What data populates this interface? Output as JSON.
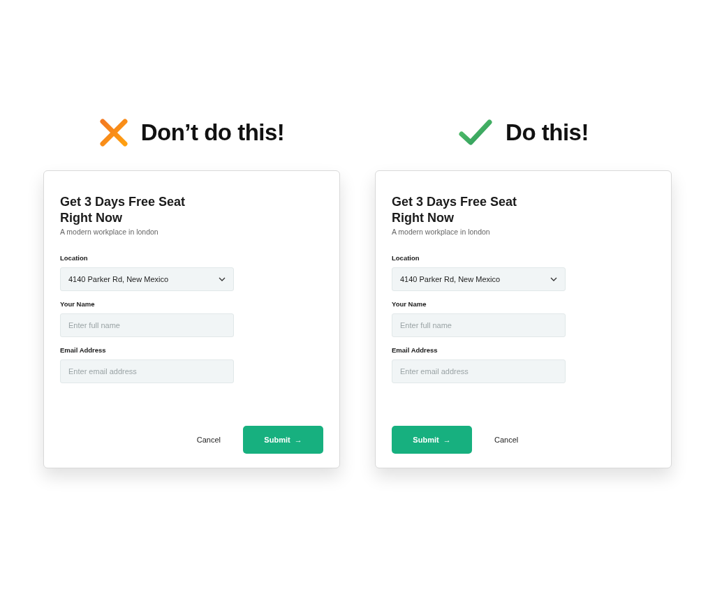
{
  "examples": [
    {
      "kind": "dont",
      "heading": "Don’t do this!",
      "form": {
        "title": "Get 3 Days Free Seat Right Now",
        "subtitle": "A modern workplace in london",
        "fields": [
          {
            "kind": "select",
            "label": "Location",
            "value": "4140 Parker Rd, New Mexico"
          },
          {
            "kind": "text",
            "label": "Your Name",
            "placeholder": "Enter full name"
          },
          {
            "kind": "text",
            "label": "Email Address",
            "placeholder": "Enter email address"
          }
        ],
        "buttons": [
          {
            "kind": "secondary",
            "label": "Cancel"
          },
          {
            "kind": "primary",
            "label": "Submit",
            "arrow": "→"
          }
        ]
      }
    },
    {
      "kind": "do",
      "heading": "Do this!",
      "form": {
        "title": "Get 3 Days Free Seat Right Now",
        "subtitle": "A modern workplace in london",
        "fields": [
          {
            "kind": "select",
            "label": "Location",
            "value": "4140 Parker Rd, New Mexico"
          },
          {
            "kind": "text",
            "label": "Your Name",
            "placeholder": "Enter full name"
          },
          {
            "kind": "text",
            "label": "Email Address",
            "placeholder": "Enter email address"
          }
        ],
        "buttons": [
          {
            "kind": "primary",
            "label": "Submit",
            "arrow": "→"
          },
          {
            "kind": "secondary",
            "label": "Cancel"
          }
        ]
      }
    }
  ]
}
